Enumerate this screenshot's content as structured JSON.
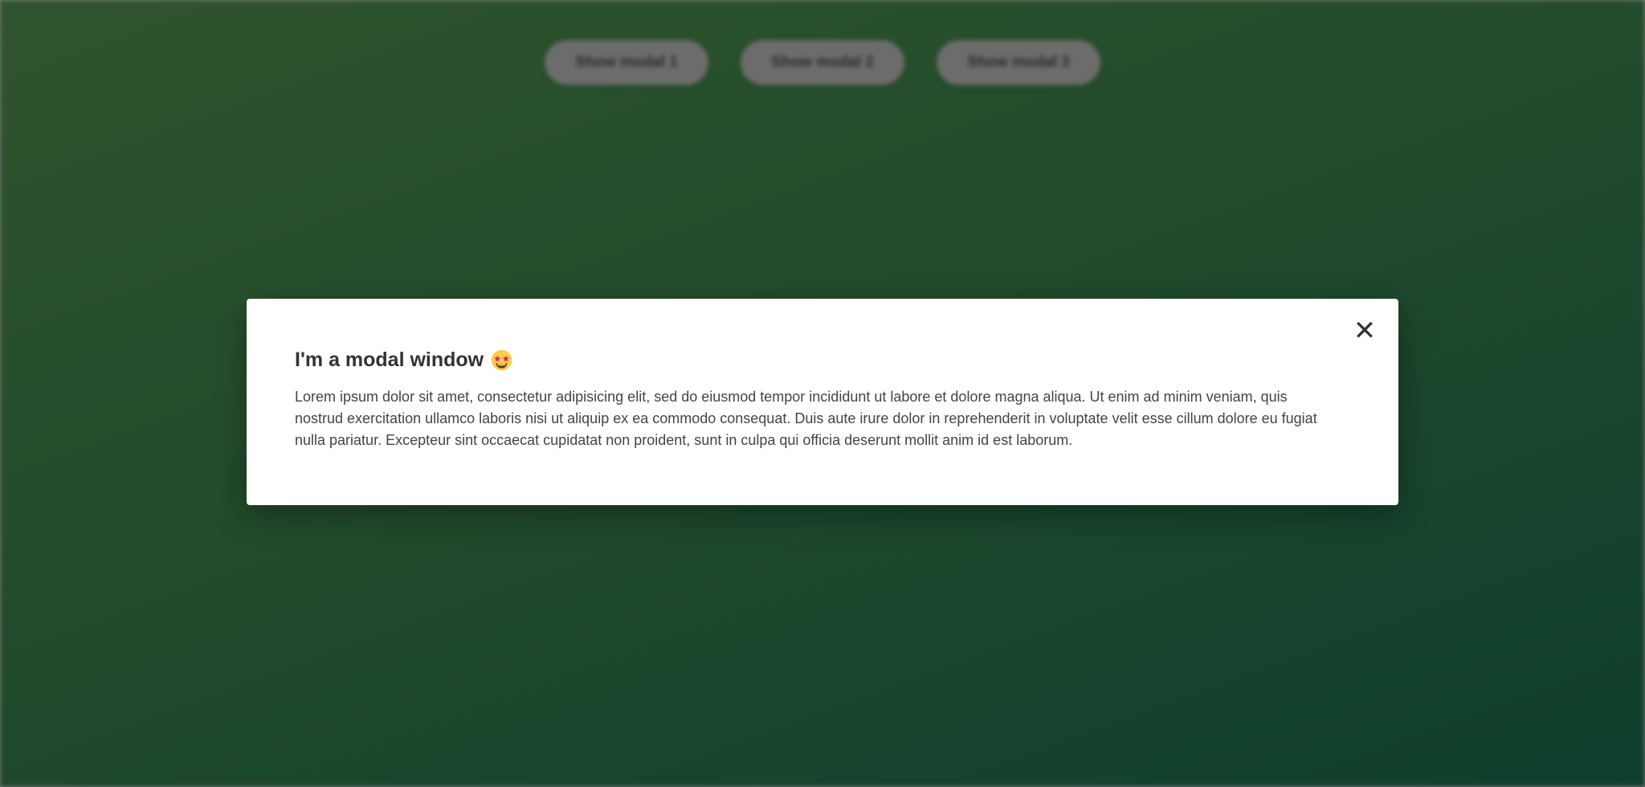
{
  "toolbar": {
    "buttons": [
      {
        "label": "Show modal 1"
      },
      {
        "label": "Show modal 2"
      },
      {
        "label": "Show modal 3"
      }
    ]
  },
  "modal": {
    "close_symbol": "✕",
    "title": "I'm a modal window",
    "title_icon": "star-struck-emoji-icon",
    "body": "Lorem ipsum dolor sit amet, consectetur adipisicing elit, sed do eiusmod tempor incididunt ut labore et dolore magna aliqua. Ut enim ad minim veniam, quis nostrud exercitation ullamco laboris nisi ut aliquip ex ea commodo consequat. Duis aute irure dolor in reprehenderit in voluptate velit esse cillum dolore eu fugiat nulla pariatur. Excepteur sint occaecat cupidatat non proident, sunt in culpa qui officia deserunt mollit anim id est laborum."
  },
  "colors": {
    "overlay": "#000000",
    "modal_background": "#ffffff",
    "text": "#333333",
    "button_background": "#d9d9d9"
  }
}
